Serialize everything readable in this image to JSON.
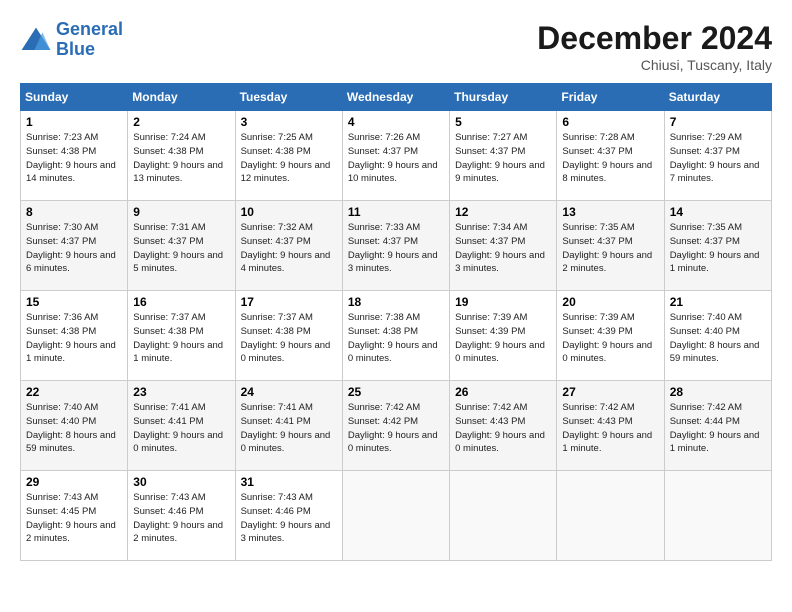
{
  "header": {
    "logo_line1": "General",
    "logo_line2": "Blue",
    "month_title": "December 2024",
    "location": "Chiusi, Tuscany, Italy"
  },
  "weekdays": [
    "Sunday",
    "Monday",
    "Tuesday",
    "Wednesday",
    "Thursday",
    "Friday",
    "Saturday"
  ],
  "weeks": [
    [
      {
        "day": "1",
        "sunrise": "7:23 AM",
        "sunset": "4:38 PM",
        "daylight": "9 hours and 14 minutes."
      },
      {
        "day": "2",
        "sunrise": "7:24 AM",
        "sunset": "4:38 PM",
        "daylight": "9 hours and 13 minutes."
      },
      {
        "day": "3",
        "sunrise": "7:25 AM",
        "sunset": "4:38 PM",
        "daylight": "9 hours and 12 minutes."
      },
      {
        "day": "4",
        "sunrise": "7:26 AM",
        "sunset": "4:37 PM",
        "daylight": "9 hours and 10 minutes."
      },
      {
        "day": "5",
        "sunrise": "7:27 AM",
        "sunset": "4:37 PM",
        "daylight": "9 hours and 9 minutes."
      },
      {
        "day": "6",
        "sunrise": "7:28 AM",
        "sunset": "4:37 PM",
        "daylight": "9 hours and 8 minutes."
      },
      {
        "day": "7",
        "sunrise": "7:29 AM",
        "sunset": "4:37 PM",
        "daylight": "9 hours and 7 minutes."
      }
    ],
    [
      {
        "day": "8",
        "sunrise": "7:30 AM",
        "sunset": "4:37 PM",
        "daylight": "9 hours and 6 minutes."
      },
      {
        "day": "9",
        "sunrise": "7:31 AM",
        "sunset": "4:37 PM",
        "daylight": "9 hours and 5 minutes."
      },
      {
        "day": "10",
        "sunrise": "7:32 AM",
        "sunset": "4:37 PM",
        "daylight": "9 hours and 4 minutes."
      },
      {
        "day": "11",
        "sunrise": "7:33 AM",
        "sunset": "4:37 PM",
        "daylight": "9 hours and 3 minutes."
      },
      {
        "day": "12",
        "sunrise": "7:34 AM",
        "sunset": "4:37 PM",
        "daylight": "9 hours and 3 minutes."
      },
      {
        "day": "13",
        "sunrise": "7:35 AM",
        "sunset": "4:37 PM",
        "daylight": "9 hours and 2 minutes."
      },
      {
        "day": "14",
        "sunrise": "7:35 AM",
        "sunset": "4:37 PM",
        "daylight": "9 hours and 1 minute."
      }
    ],
    [
      {
        "day": "15",
        "sunrise": "7:36 AM",
        "sunset": "4:38 PM",
        "daylight": "9 hours and 1 minute."
      },
      {
        "day": "16",
        "sunrise": "7:37 AM",
        "sunset": "4:38 PM",
        "daylight": "9 hours and 1 minute."
      },
      {
        "day": "17",
        "sunrise": "7:37 AM",
        "sunset": "4:38 PM",
        "daylight": "9 hours and 0 minutes."
      },
      {
        "day": "18",
        "sunrise": "7:38 AM",
        "sunset": "4:38 PM",
        "daylight": "9 hours and 0 minutes."
      },
      {
        "day": "19",
        "sunrise": "7:39 AM",
        "sunset": "4:39 PM",
        "daylight": "9 hours and 0 minutes."
      },
      {
        "day": "20",
        "sunrise": "7:39 AM",
        "sunset": "4:39 PM",
        "daylight": "9 hours and 0 minutes."
      },
      {
        "day": "21",
        "sunrise": "7:40 AM",
        "sunset": "4:40 PM",
        "daylight": "8 hours and 59 minutes."
      }
    ],
    [
      {
        "day": "22",
        "sunrise": "7:40 AM",
        "sunset": "4:40 PM",
        "daylight": "8 hours and 59 minutes."
      },
      {
        "day": "23",
        "sunrise": "7:41 AM",
        "sunset": "4:41 PM",
        "daylight": "9 hours and 0 minutes."
      },
      {
        "day": "24",
        "sunrise": "7:41 AM",
        "sunset": "4:41 PM",
        "daylight": "9 hours and 0 minutes."
      },
      {
        "day": "25",
        "sunrise": "7:42 AM",
        "sunset": "4:42 PM",
        "daylight": "9 hours and 0 minutes."
      },
      {
        "day": "26",
        "sunrise": "7:42 AM",
        "sunset": "4:43 PM",
        "daylight": "9 hours and 0 minutes."
      },
      {
        "day": "27",
        "sunrise": "7:42 AM",
        "sunset": "4:43 PM",
        "daylight": "9 hours and 1 minute."
      },
      {
        "day": "28",
        "sunrise": "7:42 AM",
        "sunset": "4:44 PM",
        "daylight": "9 hours and 1 minute."
      }
    ],
    [
      {
        "day": "29",
        "sunrise": "7:43 AM",
        "sunset": "4:45 PM",
        "daylight": "9 hours and 2 minutes."
      },
      {
        "day": "30",
        "sunrise": "7:43 AM",
        "sunset": "4:46 PM",
        "daylight": "9 hours and 2 minutes."
      },
      {
        "day": "31",
        "sunrise": "7:43 AM",
        "sunset": "4:46 PM",
        "daylight": "9 hours and 3 minutes."
      },
      null,
      null,
      null,
      null
    ]
  ]
}
